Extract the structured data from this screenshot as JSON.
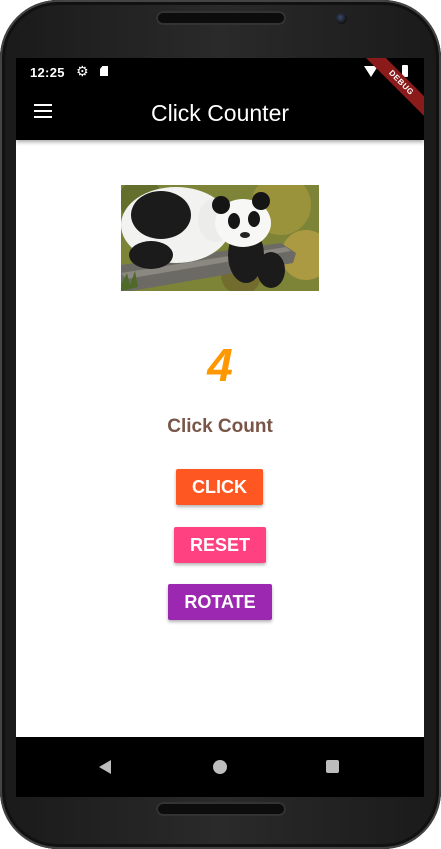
{
  "status_bar": {
    "time": "12:25",
    "icons": [
      "gear-icon",
      "sd-card-icon",
      "wifi-icon",
      "battery-icon"
    ]
  },
  "app_bar": {
    "title": "Click Counter",
    "menu_icon": "hamburger-menu-icon"
  },
  "debug_banner": "DEBUG",
  "main": {
    "image": "panda-image",
    "count": "4",
    "count_label": "Click Count",
    "buttons": {
      "click": "CLICK",
      "reset": "RESET",
      "rotate": "ROTATE"
    }
  },
  "nav_bar": {
    "icons": [
      "back-icon",
      "home-icon",
      "recents-icon"
    ]
  },
  "colors": {
    "count": "#ff9800",
    "count_label": "#795548",
    "click_button": "#ff5722",
    "reset_button": "#ff4081",
    "rotate_button": "#9c27b0",
    "app_bar": "#000000",
    "debug_banner": "#8b1a1a"
  }
}
